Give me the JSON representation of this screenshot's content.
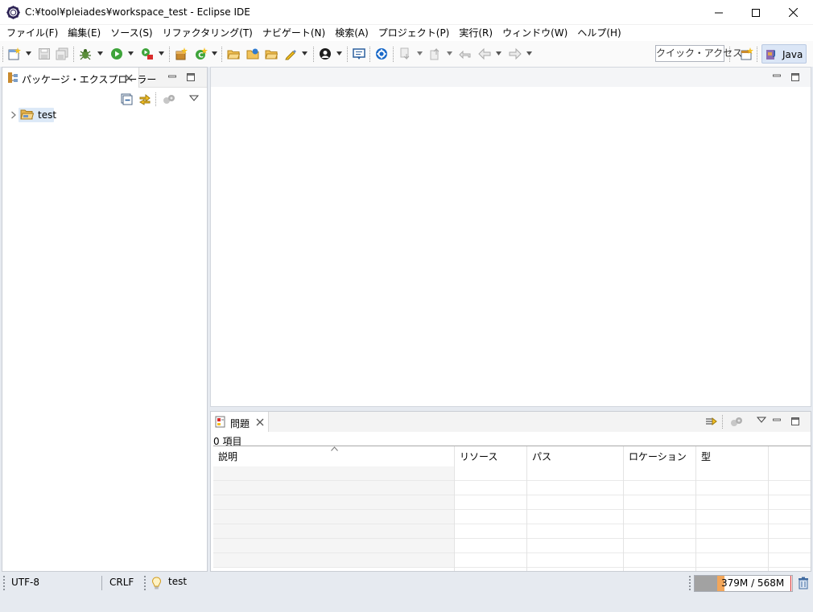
{
  "window": {
    "title": "C:¥tool¥pleiades¥workspace_test - Eclipse IDE",
    "icon": "eclipse-gear-icon"
  },
  "menu": [
    "ファイル(F)",
    "編集(E)",
    "ソース(S)",
    "リファクタリング(T)",
    "ナビゲート(N)",
    "検索(A)",
    "プロジェクト(P)",
    "実行(R)",
    "ウィンドウ(W)",
    "ヘルプ(H)"
  ],
  "toolbar": {
    "quick_access_label": "クイック・アクセス",
    "perspective_label": "Java"
  },
  "package_explorer": {
    "tab_label": "パッケージ・エクスプローラー",
    "tree": [
      {
        "label": "test",
        "expanded": false,
        "icon": "open-project-folder-icon"
      }
    ]
  },
  "problems_view": {
    "tab_label": "問題",
    "item_count": "0 項目",
    "columns": [
      "説明",
      "リソース",
      "パス",
      "ロケーション",
      "型"
    ]
  },
  "status_bar": {
    "encoding": "UTF-8",
    "line_delimiter": "CRLF",
    "selection": "test",
    "heap_text": "379M / 568M",
    "heap_used_fraction": 0.667
  },
  "colors": {
    "chrome_bg": "#e6eaf0",
    "selection_bg": "#dce9f7",
    "heap_marker": "#f2a65a",
    "accent_blue": "#1b6ac9"
  }
}
